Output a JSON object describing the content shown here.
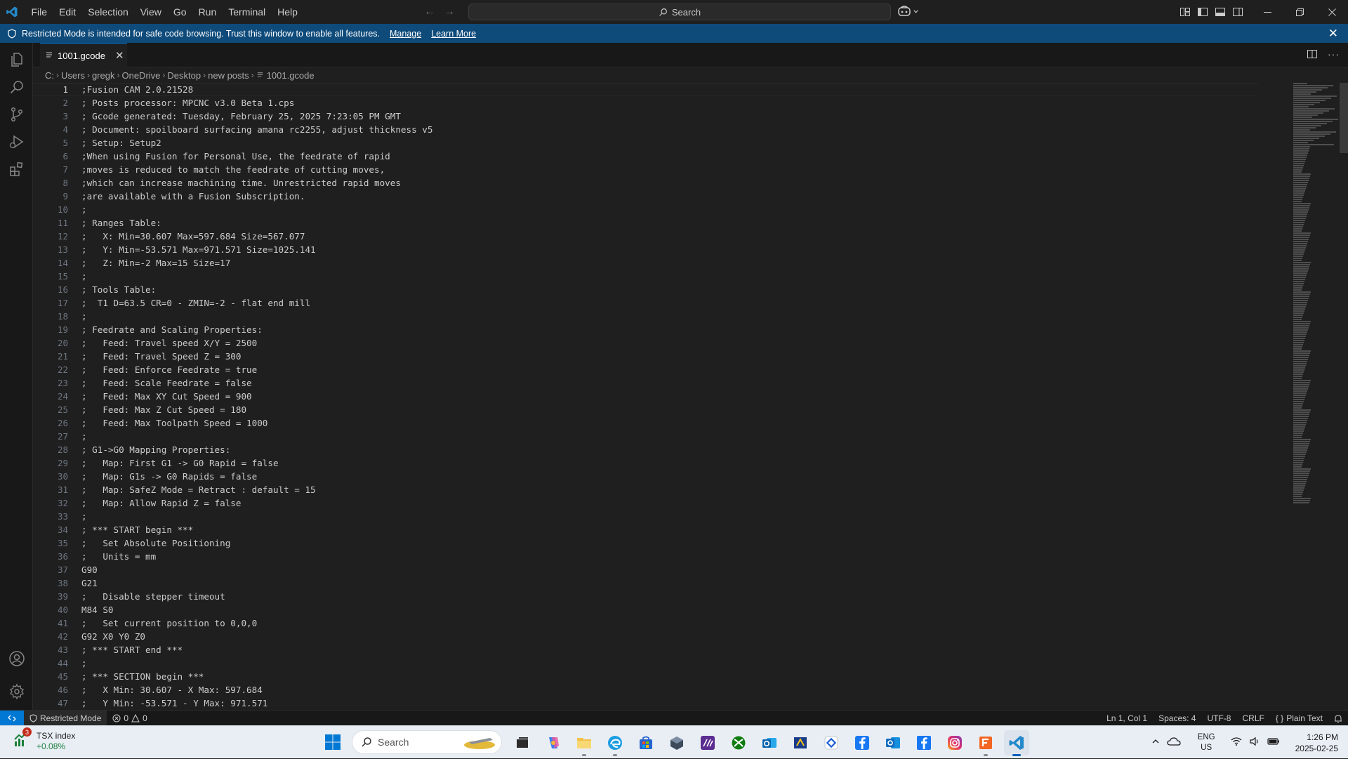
{
  "titlebar": {
    "menu": [
      "File",
      "Edit",
      "Selection",
      "View",
      "Go",
      "Run",
      "Terminal",
      "Help"
    ],
    "search_label": "Search"
  },
  "banner": {
    "message": "Restricted Mode is intended for safe code browsing. Trust this window to enable all features.",
    "manage_label": "Manage",
    "learn_more_label": "Learn More"
  },
  "tab": {
    "filename": "1001.gcode"
  },
  "breadcrumb": [
    "C:",
    "Users",
    "gregk",
    "OneDrive",
    "Desktop",
    "new posts",
    "1001.gcode"
  ],
  "editor": {
    "active_line": 1,
    "lines": [
      ";Fusion CAM 2.0.21528",
      "; Posts processor: MPCNC v3.0 Beta 1.cps",
      "; Gcode generated: Tuesday, February 25, 2025 7:23:05 PM GMT",
      "; Document: spoilboard surfacing amana rc2255, adjust thickness v5",
      "; Setup: Setup2",
      ";When using Fusion for Personal Use, the feedrate of rapid",
      ";moves is reduced to match the feedrate of cutting moves,",
      ";which can increase machining time. Unrestricted rapid moves",
      ";are available with a Fusion Subscription.",
      ";",
      "; Ranges Table:",
      ";   X: Min=30.607 Max=597.684 Size=567.077",
      ";   Y: Min=-53.571 Max=971.571 Size=1025.141",
      ";   Z: Min=-2 Max=15 Size=17",
      ";",
      "; Tools Table:",
      ";  T1 D=63.5 CR=0 - ZMIN=-2 - flat end mill",
      ";",
      "; Feedrate and Scaling Properties:",
      ";   Feed: Travel speed X/Y = 2500",
      ";   Feed: Travel Speed Z = 300",
      ";   Feed: Enforce Feedrate = true",
      ";   Feed: Scale Feedrate = false",
      ";   Feed: Max XY Cut Speed = 900",
      ";   Feed: Max Z Cut Speed = 180",
      ";   Feed: Max Toolpath Speed = 1000",
      ";",
      "; G1->G0 Mapping Properties:",
      ";   Map: First G1 -> G0 Rapid = false",
      ";   Map: G1s -> G0 Rapids = false",
      ";   Map: SafeZ Mode = Retract : default = 15",
      ";   Map: Allow Rapid Z = false",
      ";",
      "; *** START begin ***",
      ";   Set Absolute Positioning",
      ";   Units = mm",
      "G90",
      "G21",
      ";   Disable stepper timeout",
      "M84 S0",
      ";   Set current position to 0,0,0",
      "G92 X0 Y0 Z0",
      "; *** START end ***",
      ";",
      "; *** SECTION begin ***",
      ";   X Min: 30.607 - X Max: 597.684",
      ";   Y Min: -53.571 - Y Max: 971.571"
    ]
  },
  "statusbar": {
    "restricted_label": "Restricted Mode",
    "errors": "0",
    "warnings": "0",
    "position": "Ln 1, Col 1",
    "spaces": "Spaces: 4",
    "encoding": "UTF-8",
    "eol": "CRLF",
    "language": "Plain Text"
  },
  "taskbar": {
    "widget_badge": "3",
    "widget_title": "TSX index",
    "widget_change": "+0.08%",
    "search_label": "Search",
    "lang_top": "ENG",
    "lang_bottom": "US",
    "time": "1:26 PM",
    "date": "2025-02-25"
  },
  "colors": {
    "accent": "#0078d4",
    "banner_bg": "#0e4a7a",
    "editor_bg": "#1f1f1f"
  }
}
